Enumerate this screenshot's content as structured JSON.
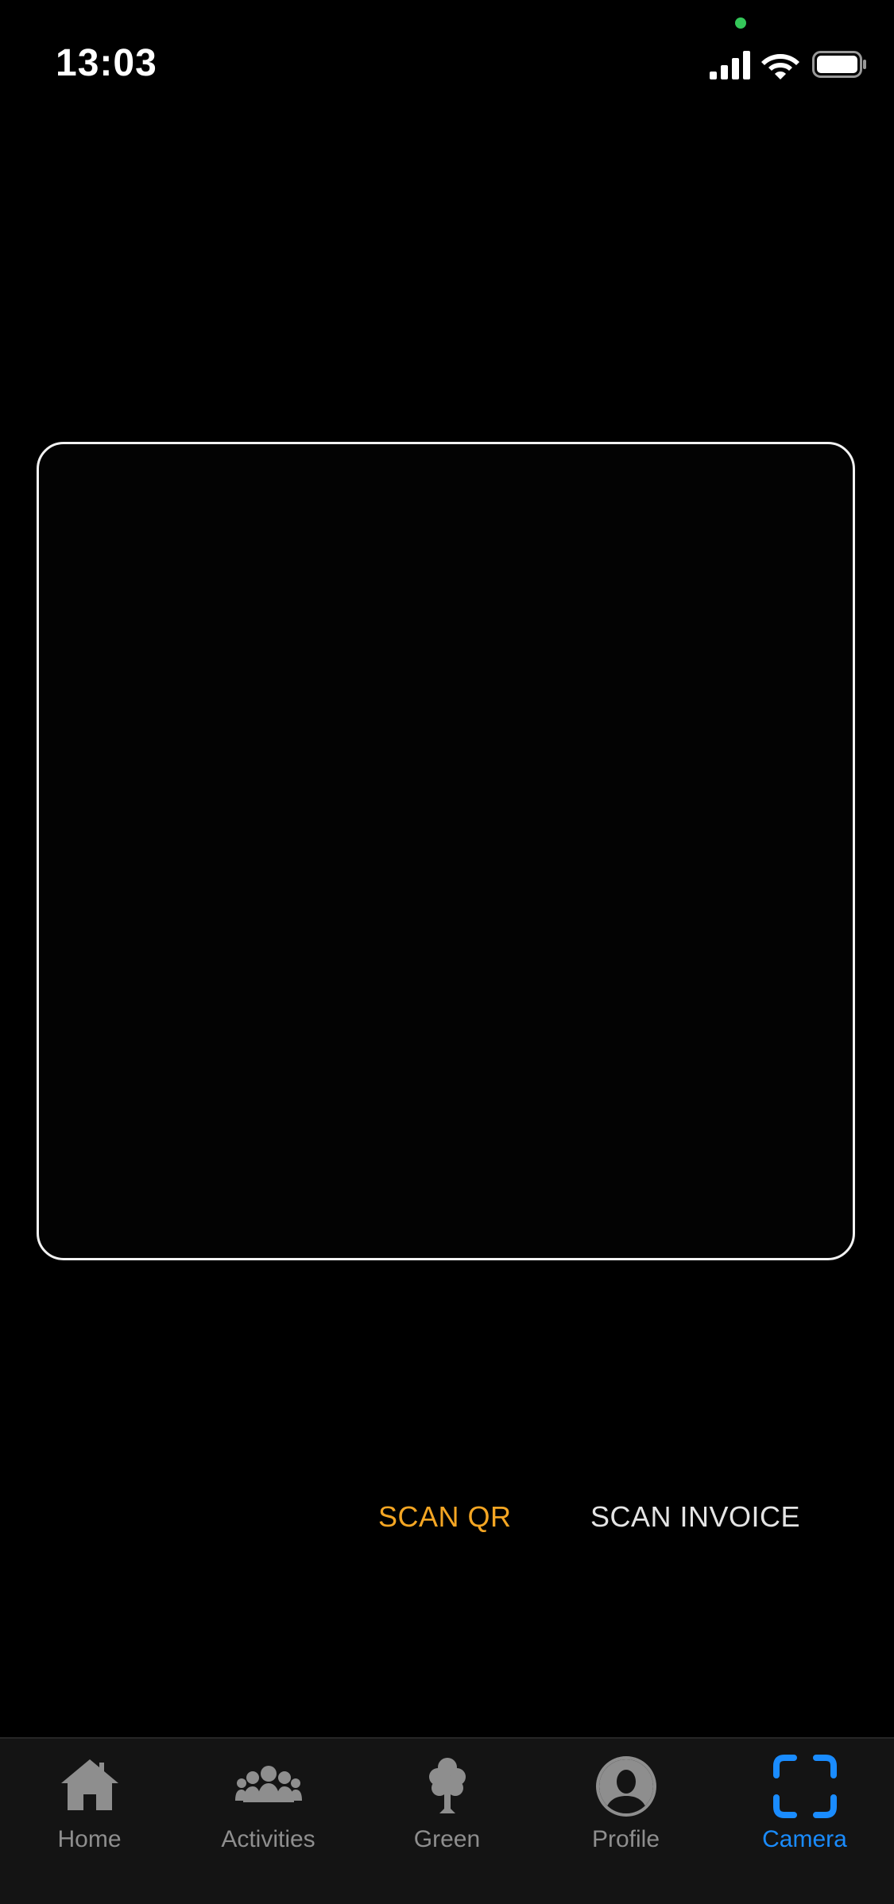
{
  "status_bar": {
    "time": "13:03",
    "signal_icon": "cellular-signal-icon",
    "wifi_icon": "wifi-icon",
    "battery_icon": "battery-icon",
    "privacy_indicator_color": "#34c759"
  },
  "scanner": {
    "frame_color": "#f2f2f2"
  },
  "modes": {
    "scan_qr": "SCAN QR",
    "scan_invoice": "SCAN INVOICE",
    "active": "SCAN QR",
    "active_color": "#f5a623"
  },
  "tab_bar": {
    "active_color": "#1a8cff",
    "inactive_color": "#8e8e8e",
    "items": [
      {
        "label": "Home",
        "icon": "home-icon"
      },
      {
        "label": "Activities",
        "icon": "group-icon"
      },
      {
        "label": "Green",
        "icon": "tree-icon"
      },
      {
        "label": "Profile",
        "icon": "profile-icon"
      },
      {
        "label": "Camera",
        "icon": "camera-scan-icon",
        "active": true
      }
    ]
  }
}
